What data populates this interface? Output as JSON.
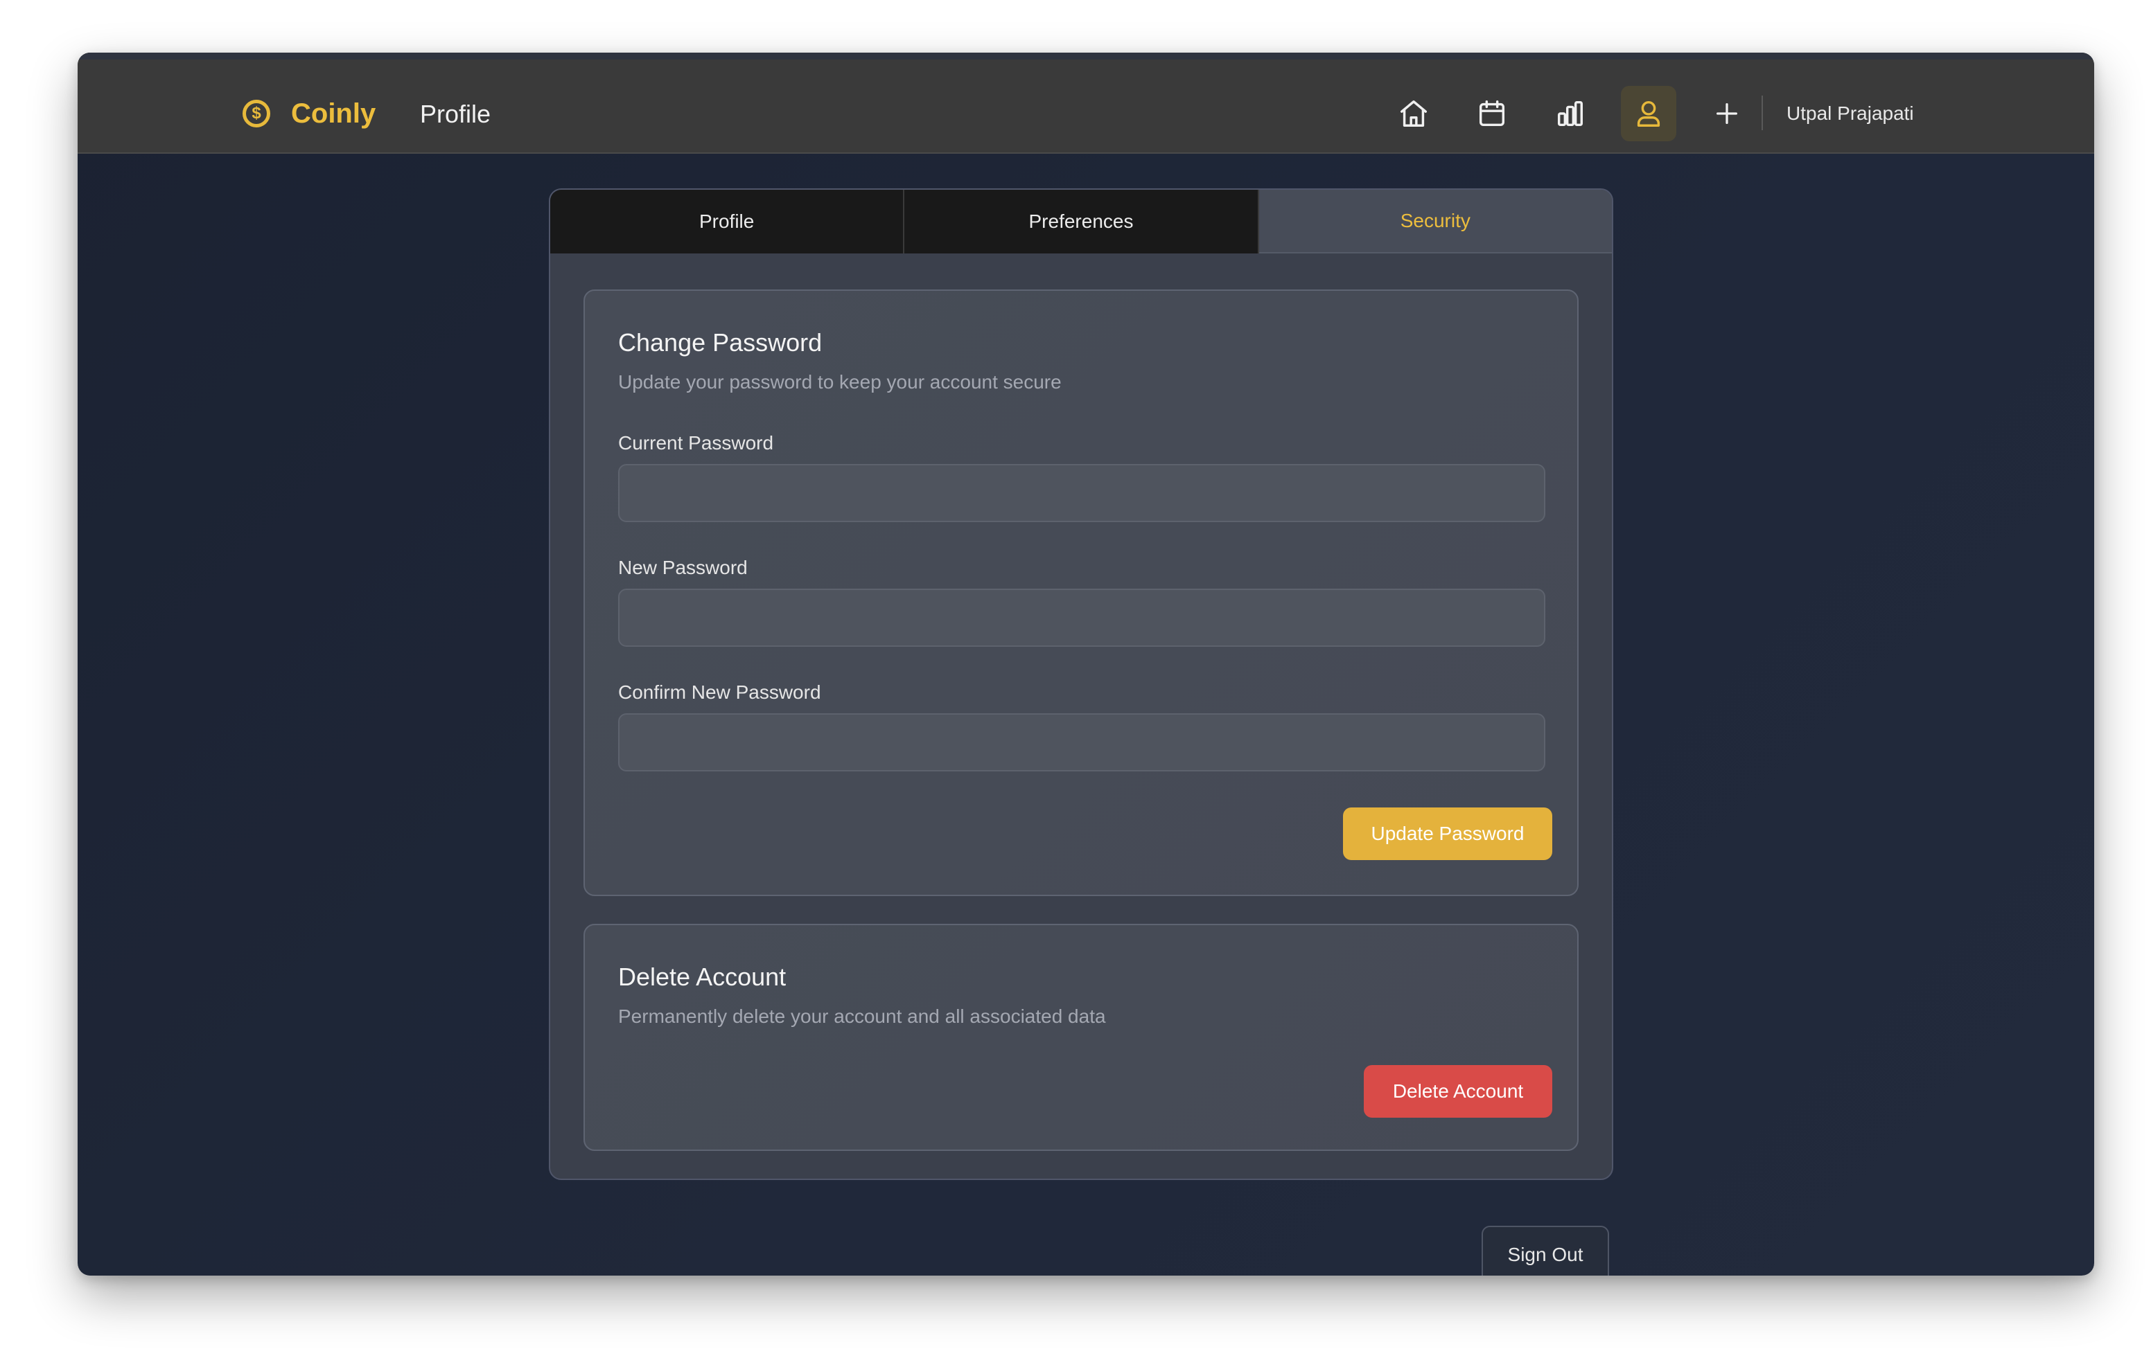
{
  "app": {
    "brand": "Coinly",
    "brand_icon": "dollar-coin-icon",
    "page_title": "Profile",
    "accent_color": "#e7b93b"
  },
  "nav": {
    "items": [
      {
        "icon": "home-icon",
        "active": false
      },
      {
        "icon": "calendar-icon",
        "active": false
      },
      {
        "icon": "bar-chart-icon",
        "active": false
      },
      {
        "icon": "user-icon",
        "active": true
      },
      {
        "icon": "plus-icon",
        "active": false
      }
    ],
    "user_name": "Utpal Prajapati"
  },
  "tabs": [
    {
      "label": "Profile",
      "active": false
    },
    {
      "label": "Preferences",
      "active": false
    },
    {
      "label": "Security",
      "active": true
    }
  ],
  "change_password": {
    "title": "Change Password",
    "subtitle": "Update your password to keep your account secure",
    "current_label": "Current Password",
    "current_value": "",
    "new_label": "New Password",
    "new_value": "",
    "confirm_label": "Confirm New Password",
    "confirm_value": "",
    "submit_label": "Update Password",
    "submit_color": "#e4b23c"
  },
  "delete_account": {
    "title": "Delete Account",
    "subtitle": "Permanently delete your account and all associated data",
    "button_label": "Delete Account",
    "button_color": "#d94b48"
  },
  "sign_out_label": "Sign Out"
}
